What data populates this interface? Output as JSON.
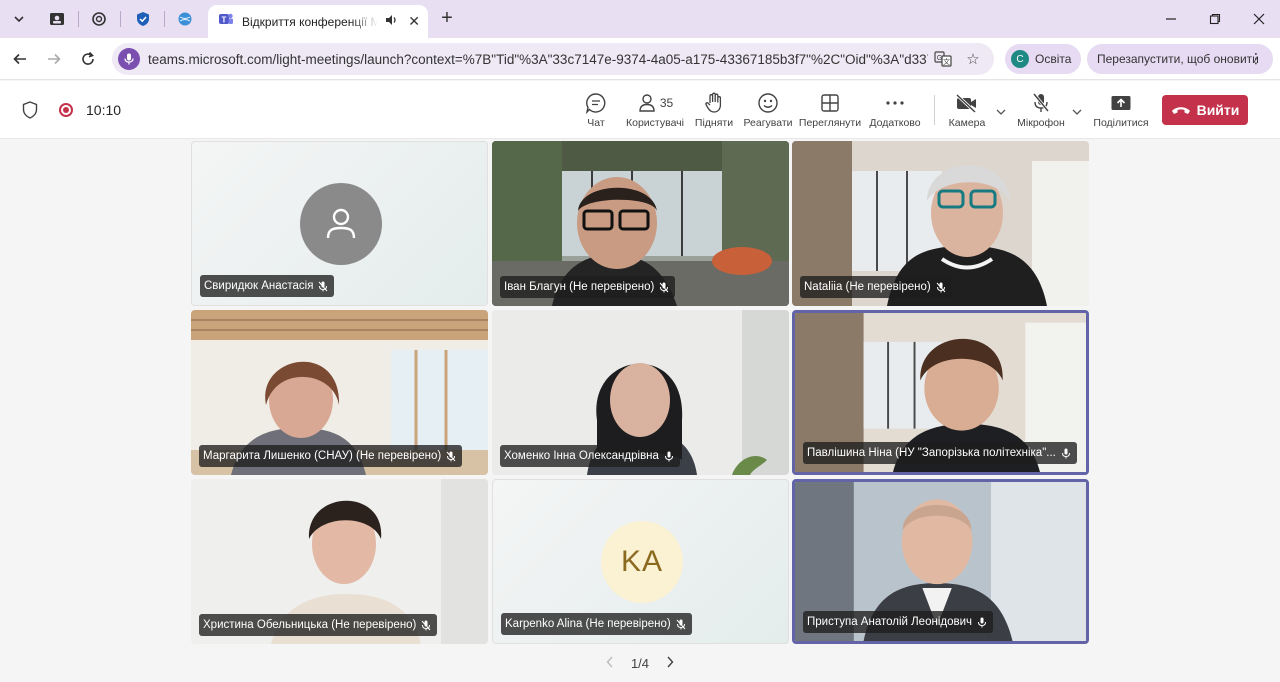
{
  "browser": {
    "active_tab_title": "Відкриття конференції Mic",
    "url": "teams.microsoft.com/light-meetings/launch?context=%7B\"Tid\"%3A\"33c7147e-9374-4a05-a175-43367185b3f7\"%2C\"Oid\"%3A\"d337...",
    "profile_initial": "С",
    "profile_name": "Освіта",
    "relaunch_label": "Перезапустити, щоб оновити"
  },
  "meeting": {
    "timer": "10:10",
    "controls": {
      "chat": "Чат",
      "people": "Користувачі",
      "people_count": "35",
      "raise": "Підняти",
      "react": "Реагувати",
      "view": "Переглянути",
      "more": "Додатково",
      "camera": "Камера",
      "mic": "Мікрофон",
      "share": "Поділитися",
      "leave": "Вийти"
    }
  },
  "participants": [
    {
      "name": "Свиридюк Анастасія"
    },
    {
      "name": "Іван Благун (Не перевірено)"
    },
    {
      "name": "Nataliia (Не перевірено)"
    },
    {
      "name": "Маргарита Лишенко (СНАУ) (Не перевірено)"
    },
    {
      "name": "Хоменко Інна Олександрівна"
    },
    {
      "name": "Павлішина Ніна (НУ \"Запорізька політехніка\"..."
    },
    {
      "name": "Христина Обельницька (Не перевірено)"
    },
    {
      "name": "Karpenko Alina (Не перевірено)",
      "initials": "KA"
    },
    {
      "name": "Приступа Анатолій Леонідович"
    }
  ],
  "pager": {
    "label": "1/4"
  },
  "colors": {
    "accent": "#6264a7",
    "leave": "#c4314b",
    "chrome": "#e9dff3"
  }
}
